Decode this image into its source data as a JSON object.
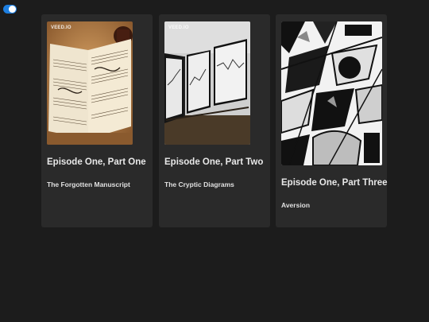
{
  "toggle": {
    "state": "on",
    "color": "#1e7fe0"
  },
  "episodes": [
    {
      "title": "Episode One, Part One",
      "subtitle": "The Forgotten Manuscript",
      "watermark": "VEED.IO",
      "thumbnail_icon": "sheet-music-image"
    },
    {
      "title": "Episode One, Part Two",
      "subtitle": "The Cryptic Diagrams",
      "watermark": "VEED.IO",
      "thumbnail_icon": "diagrams-image"
    },
    {
      "title": "Episode One, Part Three",
      "subtitle": "Aversion",
      "watermark": "",
      "thumbnail_icon": "abstract-geometric-art-image"
    }
  ]
}
